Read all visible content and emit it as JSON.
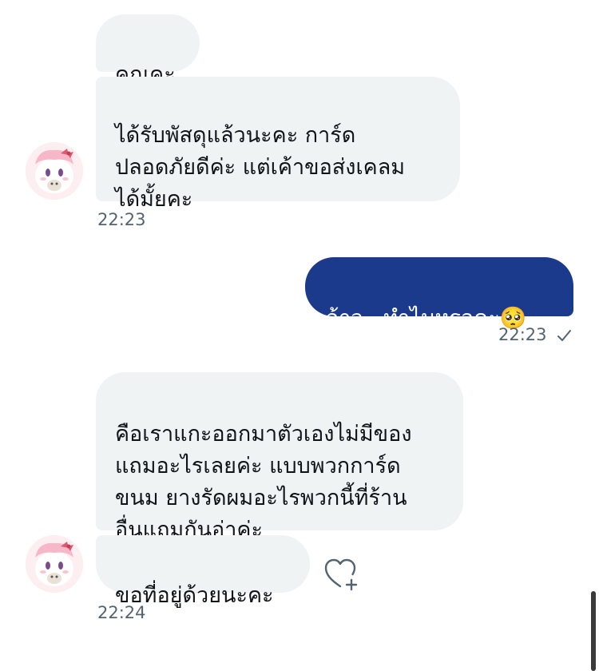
{
  "messages": [
    {
      "id": "m1",
      "direction": "incoming",
      "text": "คุณคะ"
    },
    {
      "id": "m2",
      "direction": "incoming",
      "text": "ได้รับพัสดุแล้วนะคะ การ์ด\nปลอดภัยดีค่ะ แต่เค้าขอส่งเคลม\nได้มั้ยคะ"
    },
    {
      "id": "m3",
      "direction": "outgoing",
      "text": "อ้าว...ทำไมหรอคะ🥺"
    },
    {
      "id": "m4",
      "direction": "incoming",
      "text": "คือเราแกะออกมาตัวเองไม่มีของ\nแถมอะไรเลยค่ะ แบบพวกการ์ด\nขนม ยางรัดผมอะไรพวกนี้ที่ร้าน\nอื่นแถมกันอ่าค่ะ"
    },
    {
      "id": "m5",
      "direction": "incoming",
      "text": "ขอที่อยู่ด้วยนะคะ"
    }
  ],
  "timestamps": {
    "group1": "22:23",
    "group2": "22:23",
    "group3": "22:24"
  },
  "icons": {
    "read_receipt": "checkmark-icon",
    "add_reaction": "heart-plus-icon",
    "avatar": "avatar"
  },
  "colors": {
    "incoming_bubble": "#eff3f4",
    "outgoing_bubble": "#1b3a8c",
    "timestamp": "#536471"
  }
}
